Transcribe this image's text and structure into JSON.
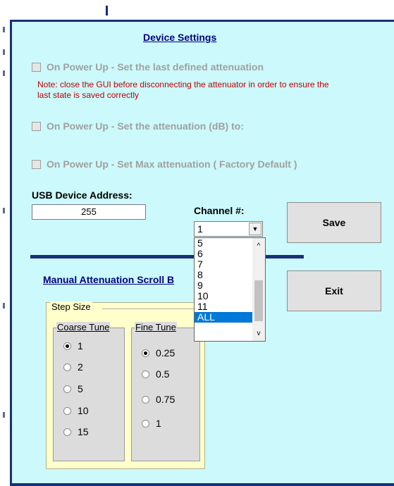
{
  "section_title": "Device Settings",
  "power_options": [
    {
      "label": "On Power Up - Set the last defined attenuation",
      "checked": false
    },
    {
      "label": "On Power Up - Set the attenuation (dB)  to:",
      "checked": false
    },
    {
      "label": "On Power Up - Set Max attenuation  ( Factory Default )",
      "checked": false
    }
  ],
  "note": "Note: close the GUI before disconnecting the attenuator in order to ensure the last state is saved correctly",
  "usb": {
    "label": "USB Device Address:",
    "value": "255"
  },
  "channel": {
    "label": "Channel #:",
    "selected": "1",
    "visible_options": [
      "5",
      "6",
      "7",
      "8",
      "9",
      "10",
      "11",
      "ALL"
    ],
    "highlighted": "ALL"
  },
  "buttons": {
    "save": "Save",
    "exit": "Exit"
  },
  "manual": {
    "title": "Manual Attenuation Scroll B"
  },
  "step_size": {
    "label": "Step Size",
    "coarse": {
      "label": "Coarse Tune",
      "options": [
        "1",
        "2",
        "5",
        "10",
        "15"
      ],
      "selected": "1"
    },
    "fine": {
      "label": "Fine Tune",
      "options": [
        "0.25",
        "0.5",
        "0.75",
        "1"
      ],
      "selected": "0.25"
    }
  },
  "colors": {
    "panel": "#ccf9fb",
    "border": "#1a2f7a",
    "title": "#000080",
    "note": "#c00000",
    "selection": "#0078d7"
  }
}
